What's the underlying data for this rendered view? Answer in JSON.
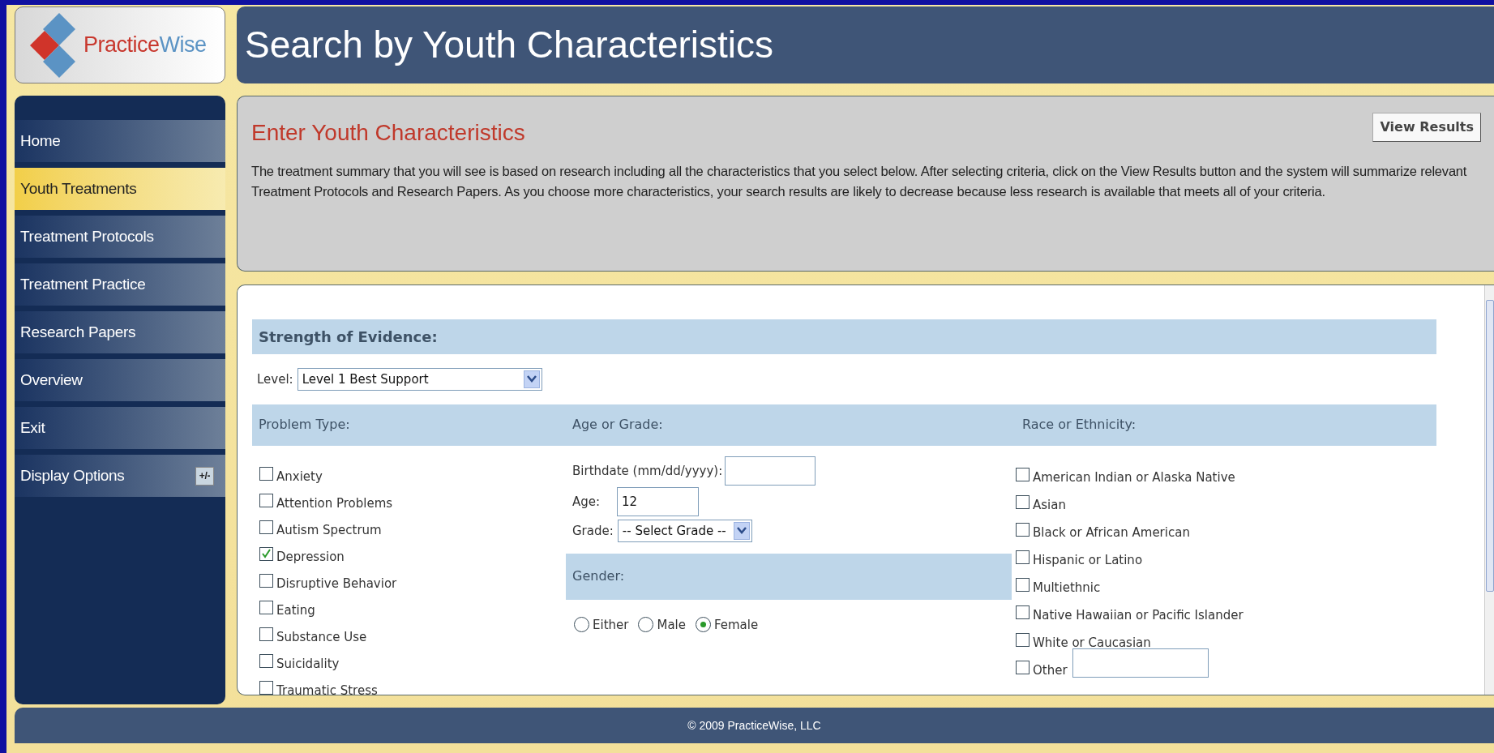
{
  "logo": {
    "parts": [
      {
        "text": "Practice",
        "color": "#c8372d"
      },
      {
        "text": "Wise",
        "color": "#5b93c4"
      }
    ]
  },
  "page_title": "Search by Youth Characteristics",
  "sidebar": {
    "items": [
      {
        "label": "Home",
        "selected": false,
        "kind": "link"
      },
      {
        "label": "Youth Treatments",
        "selected": true,
        "kind": "link"
      },
      {
        "label": "Treatment Protocols",
        "selected": false,
        "kind": "link"
      },
      {
        "label": "Treatment Practice",
        "selected": false,
        "kind": "link"
      },
      {
        "label": "Research Papers",
        "selected": false,
        "kind": "link"
      },
      {
        "label": "Overview",
        "selected": false,
        "kind": "link"
      },
      {
        "label": "Exit",
        "selected": false,
        "kind": "link"
      },
      {
        "label": "Display Options",
        "selected": false,
        "kind": "toggle",
        "button": "+/-"
      }
    ]
  },
  "intro": {
    "heading": "Enter Youth Characteristics",
    "button": "View Results",
    "text": "The treatment summary that you will see is based on research including all the characteristics that you select below. After selecting criteria, click on the View Results button and the system will summarize relevant Treatment Protocols and Research Papers. As you choose more characteristics, your search results are likely to decrease because less research is available that meets all of your criteria."
  },
  "form": {
    "evidence": {
      "heading": "Strength of Evidence:",
      "level_label": "Level:",
      "level_value": "Level 1 Best Support"
    },
    "problem_type": {
      "heading": "Problem Type:",
      "options": [
        {
          "label": "Anxiety",
          "checked": false
        },
        {
          "label": "Attention Problems",
          "checked": false
        },
        {
          "label": "Autism Spectrum",
          "checked": false
        },
        {
          "label": "Depression",
          "checked": true
        },
        {
          "label": "Disruptive Behavior",
          "checked": false
        },
        {
          "label": "Eating",
          "checked": false
        },
        {
          "label": "Substance Use",
          "checked": false
        },
        {
          "label": "Suicidality",
          "checked": false
        },
        {
          "label": "Traumatic Stress",
          "checked": false
        }
      ]
    },
    "age_grade": {
      "heading": "Age or Grade:",
      "birthdate_label": "Birthdate (mm/dd/yyyy):",
      "age_label": "Age:",
      "age_value": "12",
      "grade_label": "Grade:",
      "grade_value": "-- Select Grade --"
    },
    "gender": {
      "heading": "Gender:",
      "options": [
        {
          "label": "Either",
          "selected": false
        },
        {
          "label": "Male",
          "selected": false
        },
        {
          "label": "Female",
          "selected": true
        }
      ]
    },
    "race": {
      "heading": "Race or Ethnicity:",
      "options": [
        {
          "label": "American Indian or Alaska Native",
          "checked": false,
          "kind": "plain"
        },
        {
          "label": "Asian",
          "checked": false,
          "kind": "plain"
        },
        {
          "label": "Black or African American",
          "checked": false,
          "kind": "plain"
        },
        {
          "label": "Hispanic or Latino",
          "checked": false,
          "kind": "plain"
        },
        {
          "label": "Multiethnic",
          "checked": false,
          "kind": "plain"
        },
        {
          "label": "Native Hawaiian or Pacific Islander",
          "checked": false,
          "kind": "plain"
        },
        {
          "label": "White or Caucasian",
          "checked": false,
          "kind": "plain"
        },
        {
          "label": "Other",
          "checked": false,
          "kind": "with_field"
        }
      ]
    }
  },
  "footer": "© 2009 PracticeWise, LLC"
}
